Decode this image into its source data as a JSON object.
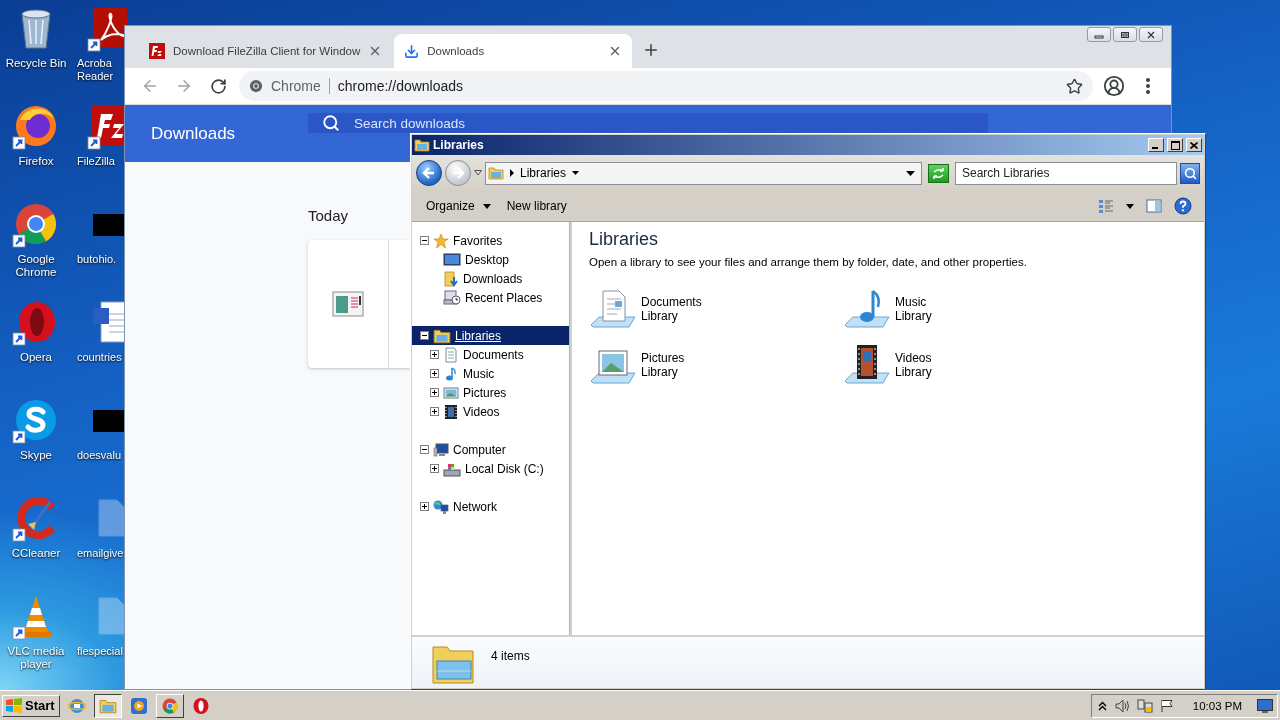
{
  "desktop": {
    "icons": [
      {
        "label": "Recycle Bin"
      },
      {
        "label": "Acroba Reader"
      },
      {
        "label": "Firefox"
      },
      {
        "label": "FileZilla"
      },
      {
        "label": "Google Chrome"
      },
      {
        "label": "butohio."
      },
      {
        "label": "Opera"
      },
      {
        "label": "countries"
      },
      {
        "label": "Skype"
      },
      {
        "label": "doesvalu"
      },
      {
        "label": "CCleaner"
      },
      {
        "label": "emailgive"
      },
      {
        "label": "VLC media player"
      },
      {
        "label": "flespecial"
      }
    ]
  },
  "chrome": {
    "tabs": [
      {
        "title": "Download FileZilla Client for Window",
        "selected": false
      },
      {
        "title": "Downloads",
        "selected": true
      }
    ],
    "omnibox": {
      "site": "Chrome",
      "url": "chrome://downloads"
    },
    "downloads": {
      "title": "Downloads",
      "search": {
        "placeholder": "Search downloads"
      },
      "date_heading": "Today"
    }
  },
  "explorer": {
    "title": "Libraries",
    "address": {
      "crumb": "Libraries"
    },
    "search": {
      "placeholder": "Search Libraries"
    },
    "toolbar": [
      {
        "label": "Organize",
        "menu": true
      },
      {
        "label": "New library",
        "menu": false
      }
    ],
    "nav": [
      {
        "label": "Favorites",
        "expanded": true,
        "selected": false,
        "children": [
          {
            "label": "Desktop",
            "selected": false
          },
          {
            "label": "Downloads",
            "selected": false
          },
          {
            "label": "Recent Places",
            "selected": false
          }
        ]
      },
      {
        "label": "Libraries",
        "expanded": true,
        "selected": true,
        "children": [
          {
            "label": "Documents",
            "expanded": false,
            "selected": false
          },
          {
            "label": "Music",
            "expanded": false,
            "selected": false
          },
          {
            "label": "Pictures",
            "expanded": false,
            "selected": false
          },
          {
            "label": "Videos",
            "expanded": false,
            "selected": false
          }
        ]
      },
      {
        "label": "Computer",
        "expanded": true,
        "selected": false,
        "children": [
          {
            "label": "Local Disk (C:)",
            "expanded": false,
            "selected": false
          }
        ]
      },
      {
        "label": "Network",
        "expanded": false,
        "selected": false
      }
    ],
    "content": {
      "heading": "Libraries",
      "description": "Open a library to see your files and arrange them by folder, date, and other properties.",
      "items": [
        {
          "name": "Documents",
          "type": "Library"
        },
        {
          "name": "Music",
          "type": "Library"
        },
        {
          "name": "Pictures",
          "type": "Library"
        },
        {
          "name": "Videos",
          "type": "Library"
        }
      ]
    },
    "status": {
      "count": "4 items"
    }
  },
  "taskbar": {
    "start": "Start",
    "apps": [
      {
        "kind": "launcher",
        "selected": false
      },
      {
        "kind": "window",
        "selected": true
      },
      {
        "kind": "launcher",
        "selected": false
      },
      {
        "kind": "window",
        "selected": false
      },
      {
        "kind": "launcher",
        "selected": false
      }
    ],
    "clock": "10:03 PM"
  }
}
